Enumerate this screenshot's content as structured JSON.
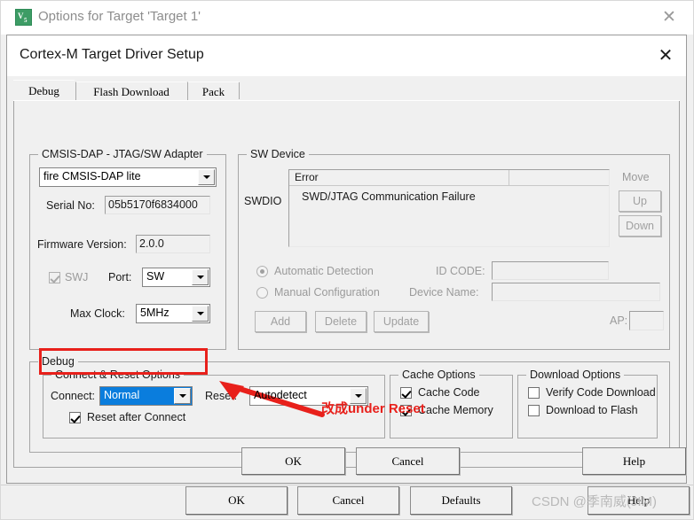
{
  "outer_window": {
    "title": "Options for Target 'Target 1'",
    "icon": "keil-uvision-icon",
    "close_label": "✕"
  },
  "inner_dialog": {
    "title": "Cortex-M Target Driver Setup",
    "close_label": "✕"
  },
  "tabs": [
    {
      "label": "Debug",
      "active": true
    },
    {
      "label": "Flash Download",
      "active": false
    },
    {
      "label": "Pack",
      "active": false
    }
  ],
  "adapter_group": {
    "title": "CMSIS-DAP - JTAG/SW Adapter",
    "adapter_select": "fire CMSIS-DAP lite",
    "serial_label": "Serial No:",
    "serial_value": "05b5170f6834000",
    "firmware_label": "Firmware Version:",
    "firmware_value": "2.0.0",
    "swj_label": "SWJ",
    "swj_checked": true,
    "port_label": "Port:",
    "port_value": "SW",
    "max_clock_label": "Max Clock:",
    "max_clock_value": "5MHz"
  },
  "sw_device_group": {
    "title": "SW Device",
    "swdio_label": "SWDIO",
    "table_headers": [
      "Error",
      ""
    ],
    "table_rows": [
      [
        "SWD/JTAG Communication Failure",
        ""
      ]
    ],
    "move_label": "Move",
    "up_label": "Up",
    "down_label": "Down",
    "automatic_detection_label": "Automatic Detection",
    "automatic_detection_selected": true,
    "manual_configuration_label": "Manual Configuration",
    "manual_configuration_selected": false,
    "id_code_label": "ID CODE:",
    "id_code_value": "",
    "device_name_label": "Device Name:",
    "device_name_value": "",
    "ap_label": "AP:",
    "ap_value": "",
    "add_label": "Add",
    "delete_label": "Delete",
    "update_label": "Update"
  },
  "debug_group": {
    "title": "Debug",
    "connect_reset_group": {
      "title": "Connect & Reset Options",
      "connect_label": "Connect:",
      "connect_value": "Normal",
      "reset_label": "Reset:",
      "reset_value": "Autodetect",
      "reset_after_connect_label": "Reset after Connect",
      "reset_after_connect_checked": true
    },
    "cache_group": {
      "title": "Cache Options",
      "cache_code_label": "Cache Code",
      "cache_code_checked": true,
      "cache_memory_label": "Cache Memory",
      "cache_memory_checked": true
    },
    "download_group": {
      "title": "Download Options",
      "verify_code_download_label": "Verify Code Download",
      "verify_code_download_checked": false,
      "download_to_flash_label": "Download to Flash",
      "download_to_flash_checked": false
    }
  },
  "annotation": {
    "text": "改成under Reset",
    "color": "#e8201b"
  },
  "inner_buttons": {
    "ok": "OK",
    "cancel": "Cancel",
    "help": "Help"
  },
  "outer_buttons": {
    "ok": "OK",
    "cancel": "Cancel",
    "defaults": "Defaults",
    "help": "Help"
  },
  "watermark": {
    "text": "CSDN @季南威(JIM)"
  },
  "colors": {
    "accent_selection": "#0a7ddd",
    "annotation_red": "#e8201b",
    "window_bg": "#f0f0f0"
  }
}
